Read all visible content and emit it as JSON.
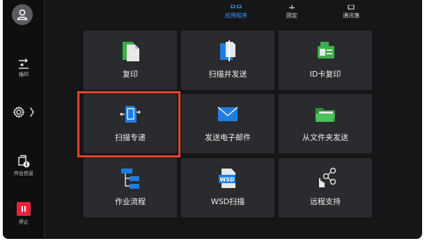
{
  "sidebar": {
    "user_icon": "user-icon",
    "interrupt_label": "插印",
    "settings_icon": "gear-icon",
    "job_info_label": "作业信息",
    "stop_label": "停止"
  },
  "top_tabs": [
    {
      "label": "应用程序",
      "active": true
    },
    {
      "label": "固定",
      "active": false
    },
    {
      "label": "通讯簿",
      "active": false
    }
  ],
  "tiles": [
    {
      "label": "复印",
      "icon": "copy-icon"
    },
    {
      "label": "扫描并发送",
      "icon": "scan-send-icon"
    },
    {
      "label": "ID卡复印",
      "icon": "id-card-copy-icon"
    },
    {
      "label": "扫描专递",
      "icon": "scan-express-icon",
      "highlighted": true
    },
    {
      "label": "发送电子邮件",
      "icon": "email-icon"
    },
    {
      "label": "从文件夹发送",
      "icon": "folder-icon"
    },
    {
      "label": "作业流程",
      "icon": "workflow-icon"
    },
    {
      "label": "WSD扫描",
      "icon": "wsd-scan-icon"
    },
    {
      "label": "远程支持",
      "icon": "remote-support-icon"
    }
  ],
  "colors": {
    "accent_blue": "#3aa0ff",
    "highlight": "#e8452c",
    "stop_red": "#e8213c"
  }
}
